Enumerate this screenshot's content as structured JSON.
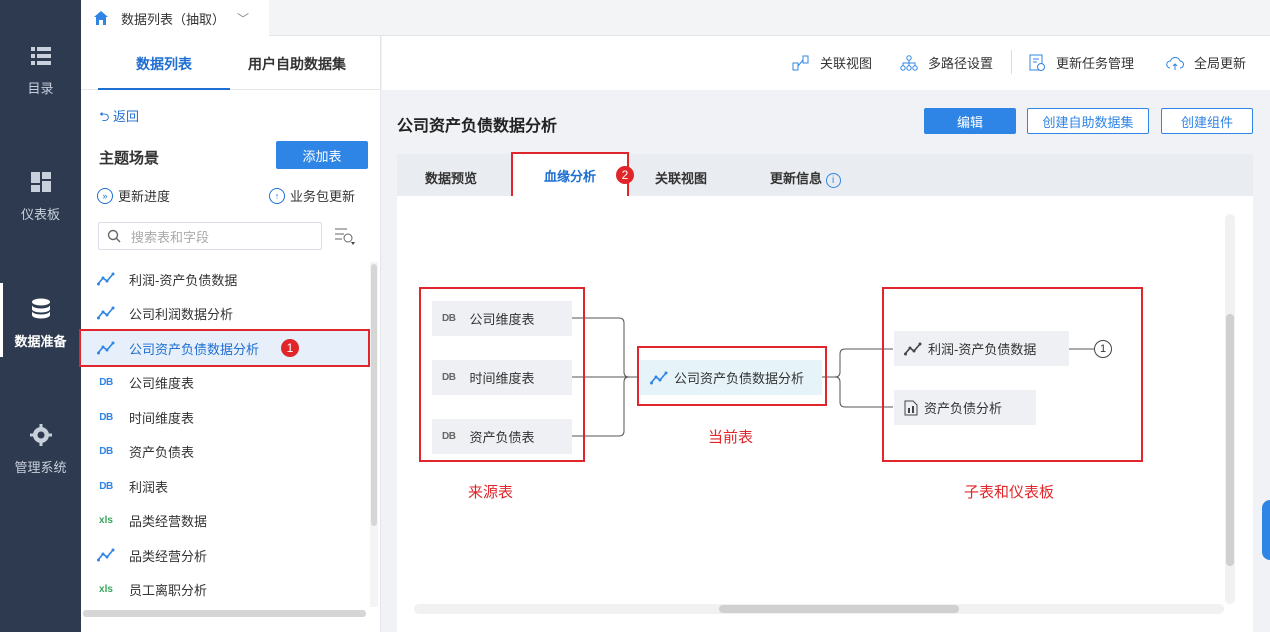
{
  "leftnav": {
    "items": [
      {
        "label": "目录",
        "icon": "list-icon"
      },
      {
        "label": "仪表板",
        "icon": "dashboard-icon"
      },
      {
        "label": "数据准备",
        "icon": "database-icon"
      },
      {
        "label": "管理系统",
        "icon": "gear-icon"
      }
    ],
    "active": "数据准备"
  },
  "topbar": {
    "doc_tab": "数据列表（抽取）"
  },
  "left_panel": {
    "tabs": [
      "数据列表",
      "用户自助数据集"
    ],
    "back": "返回",
    "section_title": "主题场景",
    "add_button": "添加表",
    "update_progress": "更新进度",
    "package_update": "业务包更新",
    "search_placeholder": "搜索表和字段",
    "tables": [
      {
        "name": "利润-资产负债数据",
        "type": "analysis"
      },
      {
        "name": "公司利润数据分析",
        "type": "analysis"
      },
      {
        "name": "公司资产负债数据分析",
        "type": "analysis",
        "selected": true,
        "badge": "1"
      },
      {
        "name": "公司维度表",
        "type": "db"
      },
      {
        "name": "时间维度表",
        "type": "db"
      },
      {
        "name": "资产负债表",
        "type": "db"
      },
      {
        "name": "利润表",
        "type": "db"
      },
      {
        "name": "品类经营数据",
        "type": "xls"
      },
      {
        "name": "品类经营分析",
        "type": "analysis"
      },
      {
        "name": "员工离职分析",
        "type": "xls"
      }
    ]
  },
  "toolbar": {
    "related_view": "关联视图",
    "multi_path": "多路径设置",
    "task_mgmt": "更新任务管理",
    "global_update": "全局更新"
  },
  "content": {
    "title": "公司资产负债数据分析",
    "edit_button": "编辑",
    "create_dataset_button": "创建自助数据集",
    "create_component_button": "创建组件",
    "tabs": [
      "数据预览",
      "血缘分析",
      "关联视图",
      "更新信息"
    ],
    "active_tab": "血缘分析",
    "tab_badge": "2"
  },
  "lineage": {
    "sources": [
      "公司维度表",
      "时间维度表",
      "资产负债表"
    ],
    "current": "公司资产负债数据分析",
    "children": [
      "利润-资产负债数据",
      "资产负债分析"
    ],
    "child_count": "1",
    "label_sources": "来源表",
    "label_current": "当前表",
    "label_children": "子表和仪表板"
  },
  "colors": {
    "accent": "#2f85e6",
    "nav_bg": "#2e3a4f",
    "highlight": "#e0262b"
  }
}
